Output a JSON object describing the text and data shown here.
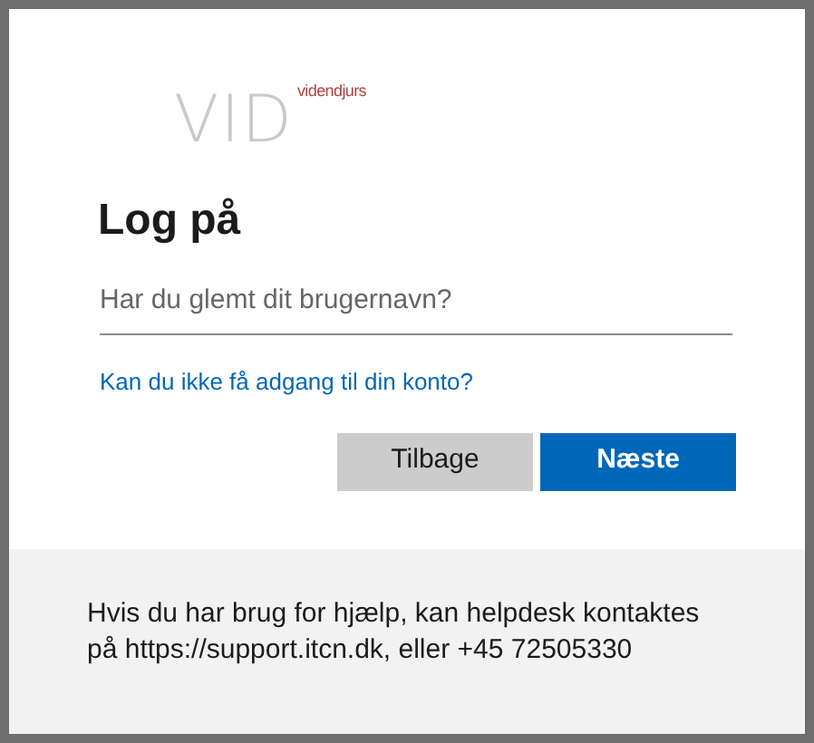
{
  "logo": {
    "mark": "VID",
    "tagline": "videndjurs"
  },
  "title": "Log på",
  "username": {
    "placeholder": "Har du glemt dit brugernavn?"
  },
  "help_link": "Kan du ikke få adgang til din konto?",
  "buttons": [
    {
      "label": "Tilbage",
      "kind": "secondary"
    },
    {
      "label": "Næste",
      "kind": "primary"
    }
  ],
  "footer": "Hvis du har brug for hjælp, kan helpdesk kontaktes på https://support.itcn.dk, eller +45 72505330"
}
